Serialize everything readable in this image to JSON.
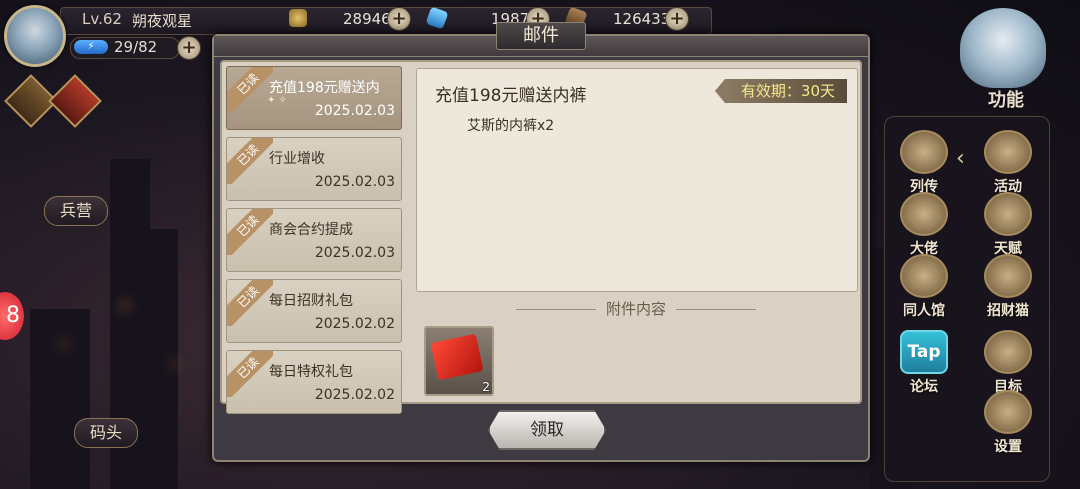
{
  "player": {
    "level": "Lv.62",
    "name": "朔夜观星",
    "energy": "29/82"
  },
  "resources": [
    {
      "icon": "coin-icon",
      "value": "28946"
    },
    {
      "icon": "gem-icon",
      "value": "1987"
    },
    {
      "icon": "wood-icon",
      "value": "126433"
    }
  ],
  "left_buttons": {
    "barracks": "兵营",
    "dock": "码头"
  },
  "right_menu": {
    "title": "功能",
    "items": [
      {
        "label": "列传",
        "icon": "book-icon"
      },
      {
        "label": "活动",
        "icon": "star-badge-icon"
      },
      {
        "label": "大佬",
        "icon": "boss-icon"
      },
      {
        "label": "天赋",
        "icon": "talent-icon"
      },
      {
        "label": "同人馆",
        "icon": "hall-icon"
      },
      {
        "label": "招财猫",
        "icon": "lucky-cat-icon"
      },
      {
        "label": "论坛",
        "icon": "tap-icon",
        "badge": "Tap"
      },
      {
        "label": "目标",
        "icon": "scroll-icon"
      },
      {
        "label": "设置",
        "icon": "gear-icon"
      }
    ]
  },
  "mail": {
    "window_title": "邮件",
    "read_tag": "已读",
    "list": [
      {
        "title": "充值198元赠送内",
        "date": "2025.02.03",
        "selected": true
      },
      {
        "title": "行业增收",
        "date": "2025.02.03"
      },
      {
        "title": "商会合约提成",
        "date": "2025.02.03"
      },
      {
        "title": "每日招财礼包",
        "date": "2025.02.02"
      },
      {
        "title": "每日特权礼包",
        "date": "2025.02.02"
      }
    ],
    "detail": {
      "title": "充值198元赠送内裤",
      "expiry": "有效期：30天",
      "body": "艾斯的内裤x2",
      "attachment_label": "附件内容",
      "attachment_count": "2"
    },
    "claim_label": "领取"
  },
  "colors": {
    "expiry_text": "#f7e98a",
    "read_tag": "#b89266"
  }
}
